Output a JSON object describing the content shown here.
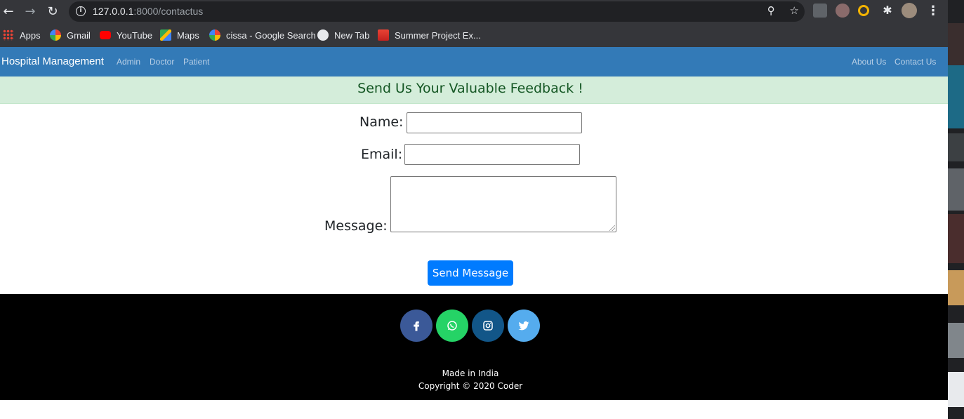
{
  "browser": {
    "url_host": "127.0.0.1",
    "url_path": ":8000/contactus",
    "bookmarks": [
      {
        "label": "Apps",
        "icon": "apps-grid-icon"
      },
      {
        "label": "Gmail",
        "icon": "google-icon"
      },
      {
        "label": "YouTube",
        "icon": "youtube-icon"
      },
      {
        "label": "Maps",
        "icon": "maps-icon"
      },
      {
        "label": "cissa - Google Search",
        "icon": "google-icon"
      },
      {
        "label": "New Tab",
        "icon": "globe-icon"
      },
      {
        "label": "Summer Project Ex...",
        "icon": "gmail-icon"
      }
    ]
  },
  "navbar": {
    "brand": "Hospital Management",
    "left_links": [
      "Admin",
      "Doctor",
      "Patient"
    ],
    "right_links": [
      "About Us",
      "Contact Us"
    ],
    "background": "#337ab7"
  },
  "feedback": {
    "title": "Send Us Your Valuable Feedback !"
  },
  "form": {
    "name_label": "Name:",
    "email_label": "Email:",
    "message_label": "Message:",
    "name_value": "",
    "email_value": "",
    "message_value": "",
    "submit_label": "Send Message"
  },
  "footer": {
    "social": [
      {
        "name": "facebook",
        "icon": "facebook-icon",
        "color": "#3b5998"
      },
      {
        "name": "whatsapp",
        "icon": "whatsapp-icon",
        "color": "#25d366"
      },
      {
        "name": "instagram",
        "icon": "instagram-icon",
        "color": "#125688"
      },
      {
        "name": "twitter",
        "icon": "twitter-icon",
        "color": "#55acee"
      }
    ],
    "made_in": "Made in India",
    "copyright": "Copyright © 2020 Coder"
  }
}
